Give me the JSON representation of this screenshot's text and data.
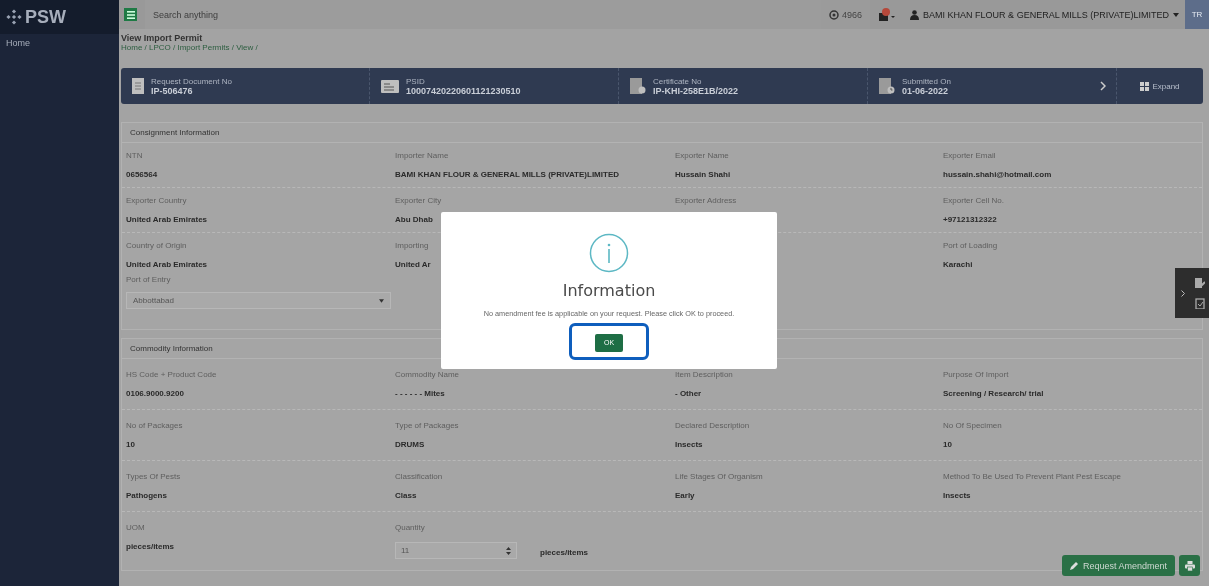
{
  "header": {
    "logo": "PSW",
    "search_placeholder": "Search anything",
    "counter": "4966",
    "user": "BAMI KHAN FLOUR & GENERAL MILLS (PRIVATE)LIMITED",
    "avatar": "TR"
  },
  "sidebar": {
    "items": [
      "Home"
    ]
  },
  "page": {
    "title": "View Import Permit",
    "breadcrumb": "Home / LPCO / Import Permits / View /"
  },
  "summary": {
    "items": [
      {
        "kind": "document",
        "label": "Request Document No",
        "value": "IP-506476"
      },
      {
        "kind": "card",
        "label": "PSID",
        "value": "10007420220601121230510"
      },
      {
        "kind": "certificate",
        "label": "Certificate No",
        "value": "IP-KHI-258E1B/2022"
      },
      {
        "kind": "calendar",
        "label": "Submitted On",
        "value": "01-06-2022"
      }
    ],
    "expand": "Expand"
  },
  "consignment": {
    "title": "Consignment Information",
    "rows": [
      [
        {
          "label": "NTN",
          "value": "0656564"
        },
        {
          "label": "Importer Name",
          "value": "BAMI KHAN FLOUR & GENERAL MILLS (PRIVATE)LIMITED"
        },
        {
          "label": "Exporter Name",
          "value": "Hussain Shahi"
        },
        {
          "label": "Exporter Email",
          "value": "hussain.shahi@hotmail.com"
        }
      ],
      [
        {
          "label": "Exporter Country",
          "value": "United Arab Emirates"
        },
        {
          "label": "Exporter City",
          "value": "Abu Dhab"
        },
        {
          "label": "Exporter Address"
        },
        {
          "label": "Exporter Cell No.",
          "value": "+97121312322"
        }
      ],
      [
        {
          "label": "Country of Origin",
          "value": "United Arab Emirates"
        },
        {
          "label": "Importing",
          "value": "United Ar"
        },
        null,
        {
          "label": "Port of Loading",
          "value": "Karachi"
        }
      ]
    ],
    "port_of_entry": {
      "label": "Port of Entry",
      "value": "Abbottabad"
    }
  },
  "commodity": {
    "title": "Commodity Information",
    "rows": [
      [
        {
          "label": "HS Code + Product Code",
          "value": "0106.9000.9200"
        },
        {
          "label": "Commodity Name",
          "value": "- - - - - - Mites"
        },
        {
          "label": "Item Description",
          "value": "- Other"
        },
        {
          "label": "Purpose Of Import",
          "value": "Screening / Research/ trial"
        }
      ],
      [
        {
          "label": "No of Packages",
          "value": "10"
        },
        {
          "label": "Type of Packages",
          "value": "DRUMS"
        },
        {
          "label": "Declared Description",
          "value": "Insects"
        },
        {
          "label": "No Of Specimen",
          "value": "10"
        }
      ],
      [
        {
          "label": "Types Of Pests",
          "value": "Pathogens"
        },
        {
          "label": "Classification",
          "value": "Class"
        },
        {
          "label": "Life Stages Of Organism",
          "value": "Early"
        },
        {
          "label": "Method To Be Used To Prevent Plant Pest Escape",
          "value": "Insects"
        }
      ]
    ],
    "uom": {
      "label": "UOM",
      "value": "pieces/items"
    },
    "quantity": {
      "label": "Quantity",
      "value": "11",
      "unit": "pieces/items"
    }
  },
  "actions": {
    "request_amendment": "Request Amendment"
  },
  "modal": {
    "title": "Information",
    "message": "No amendment fee is applicable on your request. Please click OK to proceed.",
    "button": "OK",
    "button_highlighted": true
  }
}
